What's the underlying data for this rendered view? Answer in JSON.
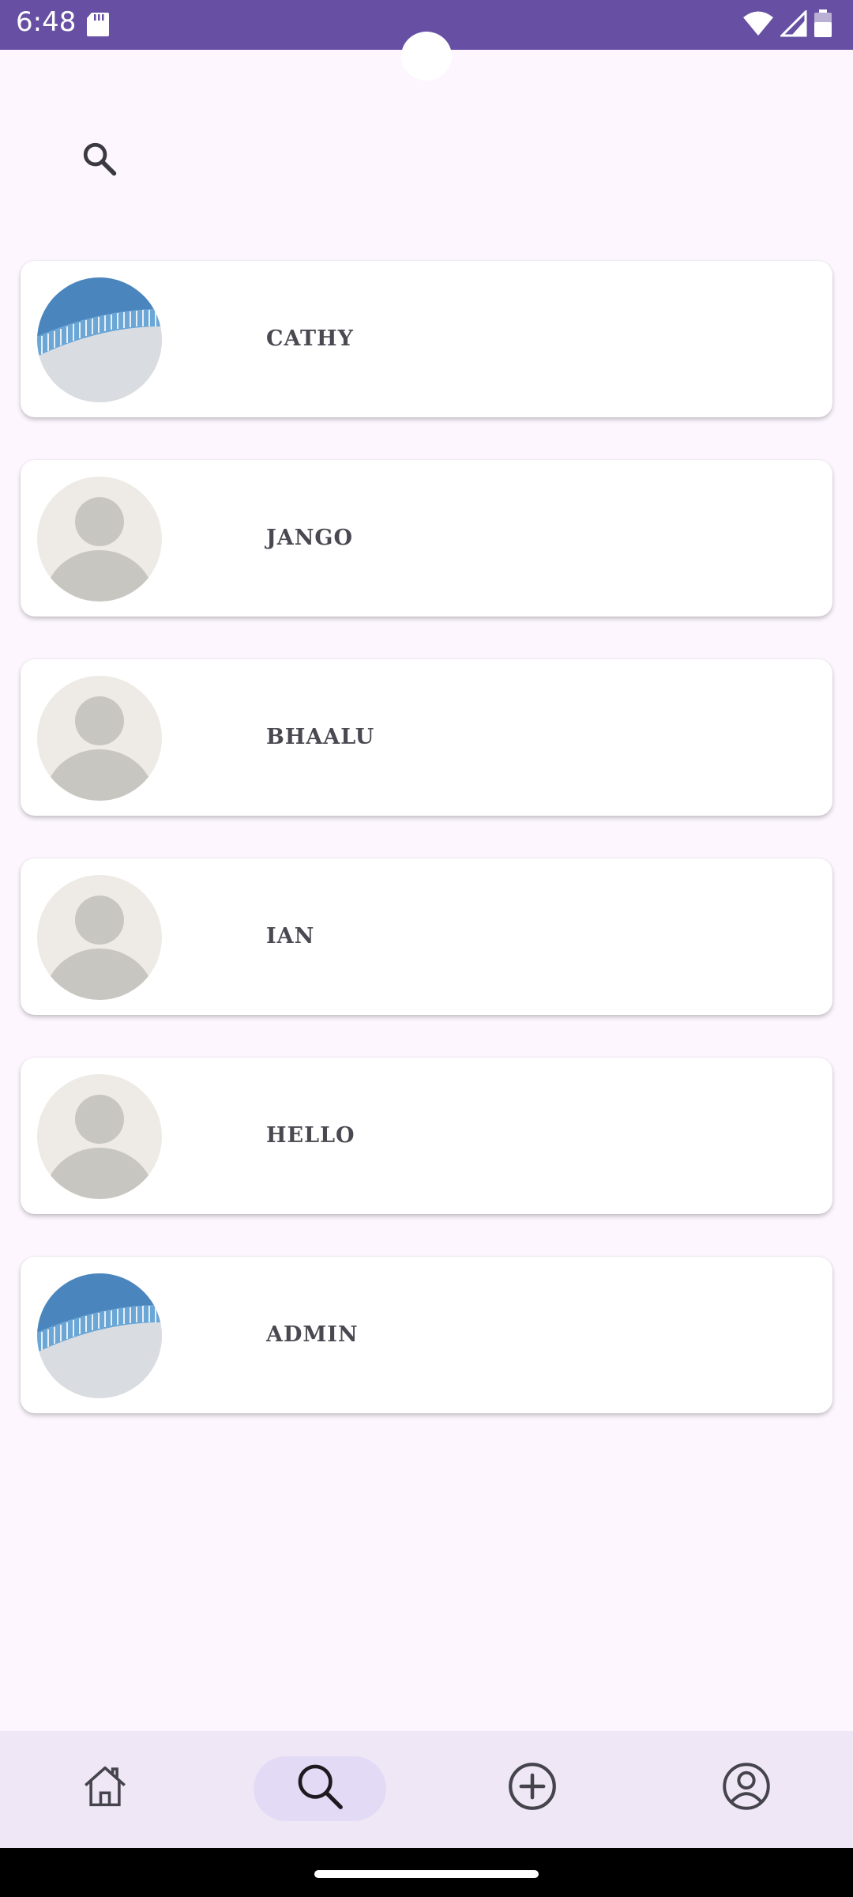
{
  "status_bar": {
    "time": "6:48",
    "color": "#6750a4"
  },
  "search": {
    "icon": "search-icon"
  },
  "users": [
    {
      "name": "CATHY",
      "avatar": "photo"
    },
    {
      "name": "JANGO",
      "avatar": "placeholder"
    },
    {
      "name": "BHAALU",
      "avatar": "placeholder"
    },
    {
      "name": "IAN",
      "avatar": "placeholder"
    },
    {
      "name": "HELLO",
      "avatar": "placeholder"
    },
    {
      "name": "ADMIN",
      "avatar": "photo"
    }
  ],
  "bottom_nav": {
    "items": [
      {
        "icon": "home-icon"
      },
      {
        "icon": "search-icon",
        "selected": true
      },
      {
        "icon": "add-circle-icon"
      },
      {
        "icon": "account-circle-icon"
      }
    ],
    "selected_color": "#e3dbf6",
    "background": "#efe7f6"
  }
}
